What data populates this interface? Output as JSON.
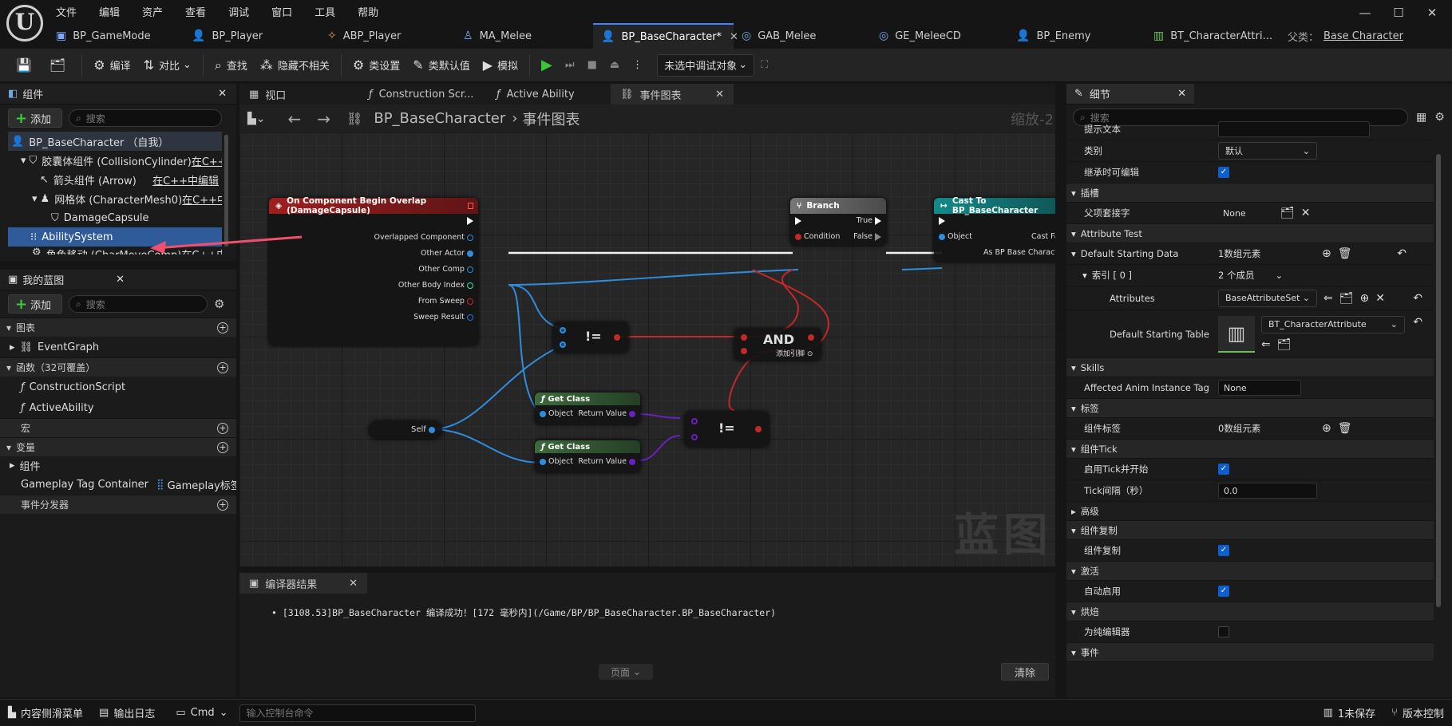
{
  "menu": [
    "文件",
    "编辑",
    "资产",
    "查看",
    "调试",
    "窗口",
    "工具",
    "帮助"
  ],
  "editor_tabs": [
    {
      "label": "BP_GameMode",
      "icon": "▣"
    },
    {
      "label": "BP_Player",
      "icon": "👤"
    },
    {
      "label": "ABP_Player",
      "icon": "✧"
    },
    {
      "label": "MA_Melee",
      "icon": "♙"
    },
    {
      "label": "BP_BaseCharacter*",
      "icon": "👤"
    },
    {
      "label": "GAB_Melee",
      "icon": "◎"
    },
    {
      "label": "GE_MeleeCD",
      "icon": "◎"
    },
    {
      "label": "BP_Enemy",
      "icon": "👤"
    },
    {
      "label": "BT_CharacterAttri...",
      "icon": "▥"
    }
  ],
  "parent_class": {
    "label": "父类：",
    "value": "Base Character"
  },
  "toolbar": {
    "compile": "编译",
    "diff": "对比",
    "find": "查找",
    "hide": "隐藏不相关",
    "class_settings": "类设置",
    "class_defaults": "类默认值",
    "simulate": "模拟",
    "debug_target": "未选中调试对象"
  },
  "components_panel": {
    "title": "组件",
    "add": "添加",
    "search_placeholder": "搜索",
    "items": [
      {
        "label": "BP_BaseCharacter （自我）",
        "link": ""
      },
      {
        "label": "胶囊体组件 (CollisionCylinder)",
        "link": "在C++"
      },
      {
        "label": "箭头组件 (Arrow)",
        "link": "在C++中编辑"
      },
      {
        "label": "网格体 (CharacterMesh0)",
        "link": "在C++中"
      },
      {
        "label": "DamageCapsule",
        "link": ""
      },
      {
        "label": "AbilitySystem",
        "link": ""
      },
      {
        "label": "角色移动 (CharMoveComp)",
        "link": "在C++中"
      }
    ]
  },
  "my_blueprint": {
    "title": "我的蓝图",
    "add": "添加",
    "search_placeholder": "搜索",
    "graphs_label": "图表",
    "event_graph": "EventGraph",
    "functions_label": "函数（32可覆盖）",
    "functions": [
      "ConstructionScript",
      "ActiveAbility"
    ],
    "macros_label": "宏",
    "variables_label": "变量",
    "components_label": "组件",
    "var_name": "Gameplay Tag Container",
    "var_type": "Gameplay标签",
    "dispatchers_label": "事件分发器"
  },
  "graph_tabs": [
    "视口",
    "Construction Scr...",
    "Active Ability",
    "事件图表"
  ],
  "breadcrumb": {
    "root": "BP_BaseCharacter",
    "current": "事件图表",
    "zoom": "缩放-2"
  },
  "nodes": {
    "overlap": {
      "title": "On Component Begin Overlap (DamageCapsule)",
      "pins": [
        "Overlapped Component",
        "Other Actor",
        "Other Comp",
        "Other Body Index",
        "From Sweep",
        "Sweep Result"
      ]
    },
    "branch": {
      "title": "Branch",
      "true": "True",
      "false": "False",
      "condition": "Condition"
    },
    "cast": {
      "title": "Cast To BP_BaseCharacter",
      "object": "Object",
      "failed": "Cast Failed",
      "as": "As BP Base Character"
    },
    "neq": "!=",
    "and": {
      "title": "AND",
      "add_pin": "添加引脚"
    },
    "getclass": {
      "title": "Get Class",
      "object": "Object",
      "ret": "Return Value"
    },
    "self": "Self"
  },
  "watermark": "蓝图",
  "compiler": {
    "title": "编译器结果",
    "message": "[3108.53]BP_BaseCharacter 编译成功！[172 毫秒内](/Game/BP/BP_BaseCharacter.BP_BaseCharacter)",
    "page": "页面",
    "clear": "清除"
  },
  "details": {
    "title": "细节",
    "search_placeholder": "搜索",
    "tooltip_label": "提示文本",
    "category_label": "类别",
    "category_value": "默认",
    "inherit_label": "继承时可编辑",
    "socket_section": "插槽",
    "parent_socket": "父项套接字",
    "parent_socket_value": "None",
    "attr_section": "Attribute Test",
    "dsd_label": "Default Starting Data",
    "dsd_value": "1数组元素",
    "index_label": "索引 [ 0 ]",
    "index_value": "2 个成员",
    "attributes_label": "Attributes",
    "attributes_value": "BaseAttributeSet",
    "dst_label": "Default Starting Table",
    "dst_value": "BT_CharacterAttribute",
    "skills_section": "Skills",
    "anim_tag_label": "Affected Anim Instance Tag",
    "anim_tag_value": "None",
    "tags_section": "标签",
    "comp_tags_label": "组件标签",
    "comp_tags_value": "0数组元素",
    "tick_section": "组件Tick",
    "tick_start": "启用Tick并开始",
    "tick_interval": "Tick间隔（秒）",
    "tick_interval_value": "0.0",
    "advanced": "高级",
    "repl_section": "组件复制",
    "repl_label": "组件复制",
    "activation_section": "激活",
    "auto_activate": "自动启用",
    "cook_section": "烘焙",
    "editor_only": "为纯编辑器",
    "events_section": "事件"
  },
  "statusbar": {
    "content_drawer": "内容侧滑菜单",
    "output_log": "输出日志",
    "cmd": "Cmd",
    "console_placeholder": "输入控制台命令",
    "unsaved": "1未保存",
    "source_control": "版本控制"
  },
  "colors": {
    "accent": "#3d86ff",
    "event_head": "#8b1a1a",
    "branch_head": "#5a5a5a",
    "cast_head": "#126d6d",
    "func_head": "#2a4a2a",
    "arrow": "#f0506e"
  }
}
